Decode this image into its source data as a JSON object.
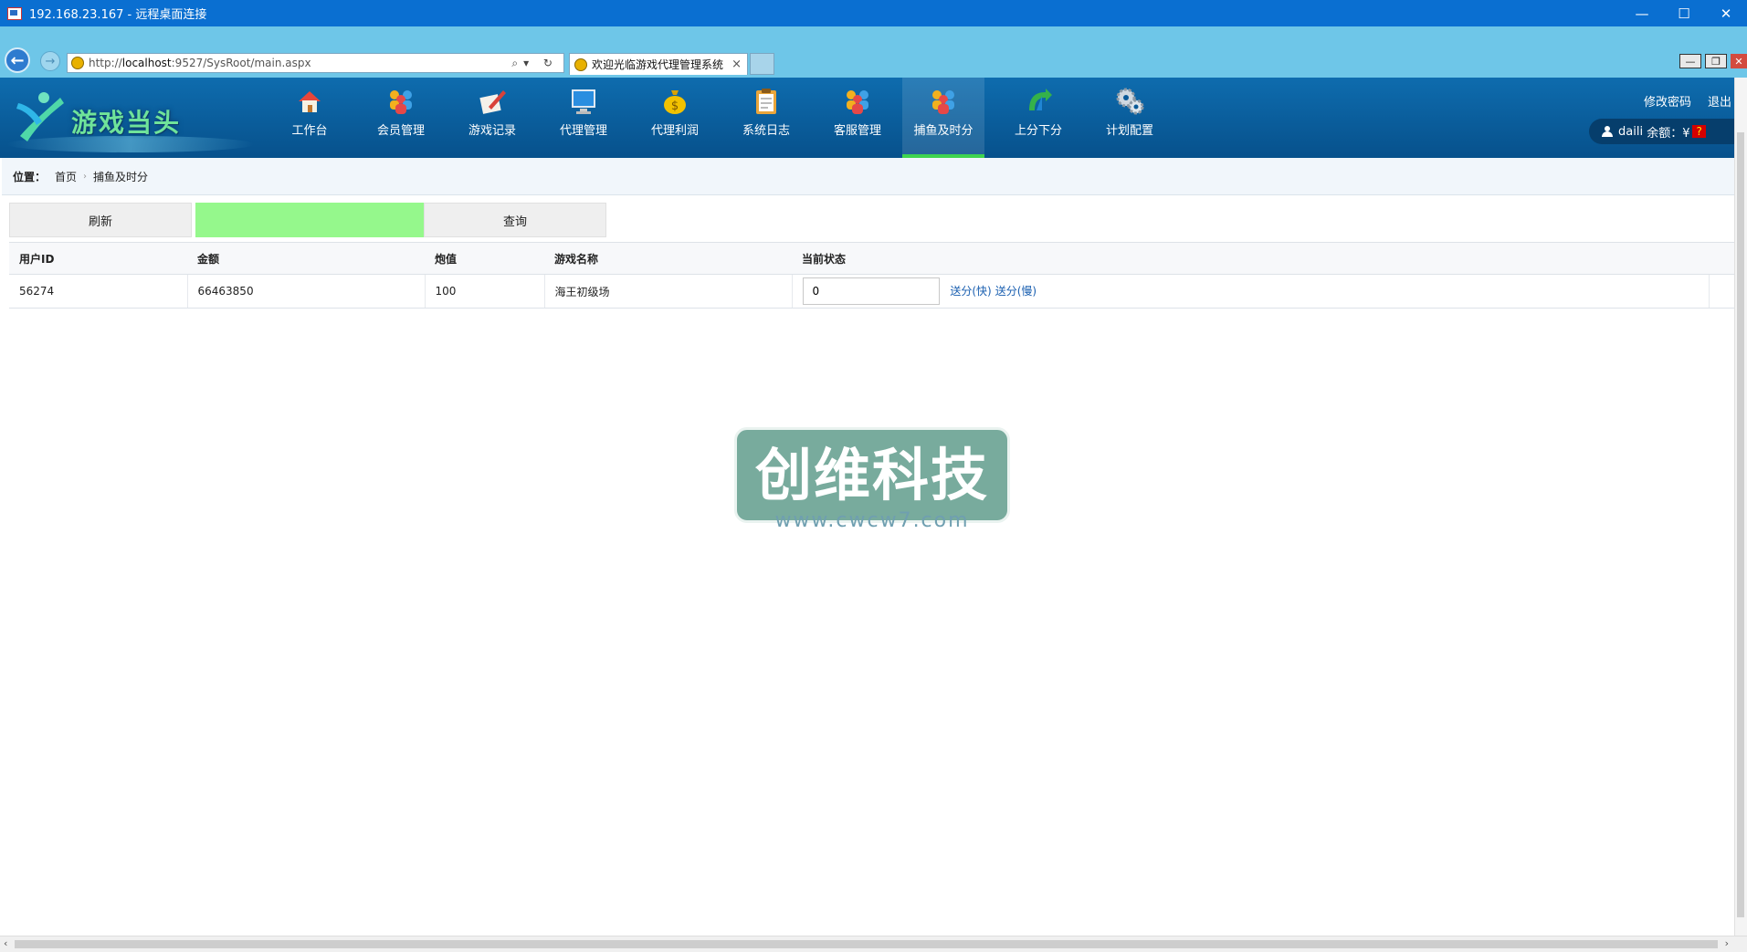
{
  "rdp": {
    "title": "192.168.23.167 - 远程桌面连接"
  },
  "browser": {
    "address_prefix": "http://",
    "address_host": "localhost",
    "address_rest": ":9527/SysRoot/main.aspx",
    "address_tools": "⌕▾ ↻",
    "tab_title": "欢迎光临游戏代理管理系统",
    "tab_close": "×"
  },
  "header": {
    "logo_text": "游戏当头",
    "nav": [
      {
        "label": "工作台",
        "icon": "home-icon"
      },
      {
        "label": "会员管理",
        "icon": "members-icon"
      },
      {
        "label": "游戏记录",
        "icon": "notes-icon"
      },
      {
        "label": "代理管理",
        "icon": "monitor-icon"
      },
      {
        "label": "代理利润",
        "icon": "money-bag-icon"
      },
      {
        "label": "系统日志",
        "icon": "clipboard-icon"
      },
      {
        "label": "客服管理",
        "icon": "people-icon"
      },
      {
        "label": "捕鱼及时分",
        "icon": "people-icon"
      },
      {
        "label": "上分下分",
        "icon": "arrows-icon"
      },
      {
        "label": "计划配置",
        "icon": "gears-icon"
      }
    ],
    "active_index": 7,
    "change_password": "修改密码",
    "logout": "退出",
    "username": "daili",
    "balance_label": "余额：¥",
    "balance_value": "?"
  },
  "breadcrumb": {
    "label": "位置：",
    "home": "首页",
    "separator": "›",
    "current": "捕鱼及时分"
  },
  "toolbar": {
    "refresh": "刷新",
    "query": "查询"
  },
  "table": {
    "headers": [
      "用户ID",
      "金额",
      "炮值",
      "游戏名称",
      "当前状态"
    ],
    "rows": [
      {
        "user_id": "56274",
        "amount": "66463850",
        "cannon": "100",
        "game": "海王初级场",
        "status_value": "0",
        "send_fast": "送分(快)",
        "send_slow": "送分(慢)"
      }
    ]
  },
  "watermark": {
    "title": "创维科技",
    "url": "www.cwcw7.com"
  },
  "colors": {
    "header_bg": "#0b5f9f",
    "active_underline": "#3ed44f",
    "green_button": "#95f88c",
    "link": "#1a5fb0"
  }
}
